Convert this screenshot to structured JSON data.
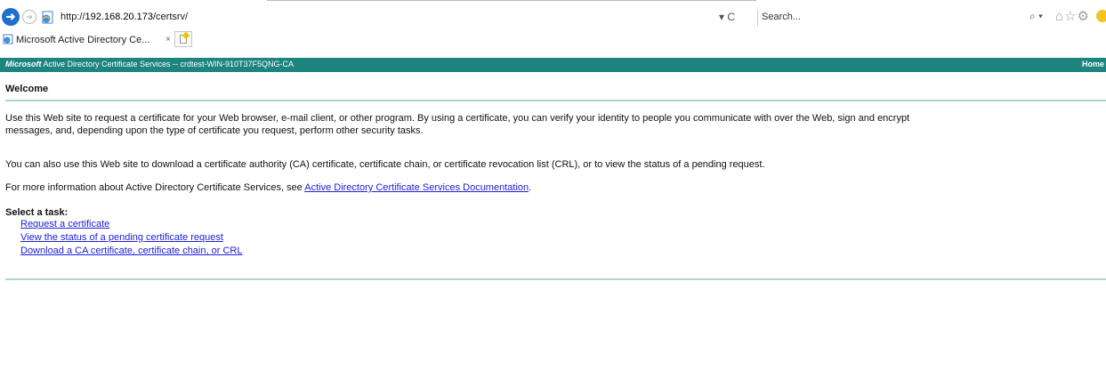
{
  "browser": {
    "url_prefix": "http://",
    "url_host": "192.168.20.173",
    "url_path": "/certsrv/",
    "address_controls": "▾ C",
    "search_placeholder": "Search...",
    "search_controls": "⌕ ▾",
    "tab_title": "Microsoft Active Directory Ce...",
    "tab_close": "×"
  },
  "banner": {
    "brand": "Microsoft",
    "title": " Active Directory Certificate Services  --  crdtest-WIN-910T37F5QNG-CA",
    "home_label": "Home"
  },
  "page": {
    "heading": "Welcome",
    "para1_line1": "Use this Web site to request a certificate for your Web browser, e-mail client, or other program. By using a certificate, you can verify your identity to people you communicate with over the Web, sign and encrypt",
    "para1_line2": "messages, and, depending upon the type of certificate you request, perform other security tasks.",
    "para2": "You can also use this Web site to download a certificate authority (CA) certificate, certificate chain, or certificate revocation list (CRL), or to view the status of a pending request.",
    "para3_prefix": "For more information about Active Directory Certificate Services, see ",
    "para3_link": "Active Directory Certificate Services Documentation",
    "para3_suffix": ".",
    "select_task": "Select a task:",
    "tasks": [
      "Request a certificate",
      "View the status of a pending certificate request",
      "Download a CA certificate, certificate chain, or CRL"
    ]
  },
  "colors": {
    "banner": "#1e847e",
    "rule": "#a9d6d3",
    "link": "#1f20d6"
  }
}
